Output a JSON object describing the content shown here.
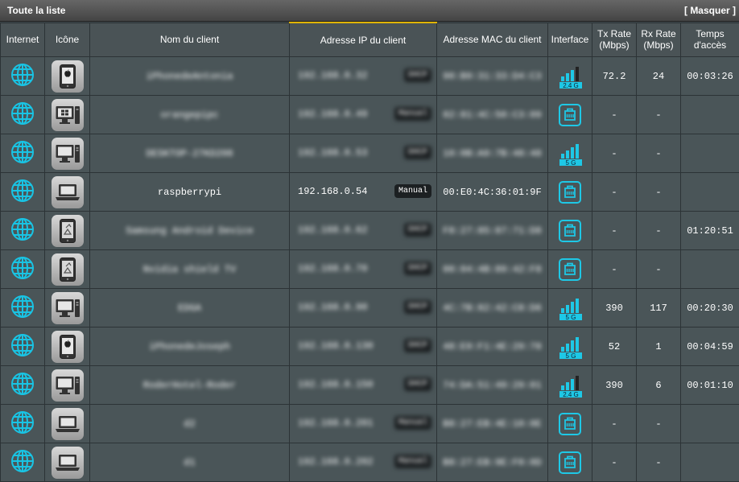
{
  "header": {
    "title": "Toute la liste",
    "hide_label": "[ Masquer ]"
  },
  "columns": [
    "Internet",
    "Icône",
    "Nom du client",
    "Adresse IP du client",
    "Adresse MAC du client",
    "Interface",
    "Tx Rate (Mbps)",
    "Rx Rate (Mbps)",
    "Temps d'accès"
  ],
  "colors": {
    "accent": "#1ec8e6",
    "sort_highlight": "#e0b400",
    "row_bg": "#4a5558",
    "header_bg": "#4a5356"
  },
  "rows": [
    {
      "device": "phone-apple",
      "name": "iPhonedeAntonia",
      "ip": "192.168.0.32",
      "tag": "DHCP",
      "mac": "90:B9:31:33:D4:C3",
      "interface": "wifi-2.4G",
      "interface_label": "2.4 G",
      "tx": "72.2",
      "rx": "24",
      "time": "00:03:26",
      "blurred": true
    },
    {
      "device": "desktop-windows",
      "name": "orangepipc",
      "ip": "192.168.0.49",
      "tag": "Manual",
      "mac": "02:81:4C:50:C3:09",
      "interface": "wired",
      "interface_label": "",
      "tx": "-",
      "rx": "-",
      "time": "",
      "blurred": true
    },
    {
      "device": "desktop",
      "name": "DESKTOP-27KD208",
      "ip": "192.168.0.53",
      "tag": "DHCP",
      "mac": "10:0B:A9:7B:48:48",
      "interface": "wifi-5G",
      "interface_label": "5 G",
      "tx": "-",
      "rx": "-",
      "time": "",
      "blurred": true
    },
    {
      "device": "laptop",
      "name": "raspberrypi",
      "ip": "192.168.0.54",
      "tag": "Manual",
      "mac": "00:E0:4C:36:01:9F",
      "interface": "wired",
      "interface_label": "",
      "tx": "-",
      "rx": "-",
      "time": "",
      "blurred": false
    },
    {
      "device": "phone-android",
      "name": "Samsung Android Device",
      "ip": "192.168.0.62",
      "tag": "DHCP",
      "mac": "F8:27:85:87:71:D8",
      "interface": "wired",
      "interface_label": "",
      "tx": "-",
      "rx": "-",
      "time": "01:20:51",
      "blurred": true
    },
    {
      "device": "phone-android",
      "name": "Nvidia shield TV",
      "ip": "192.168.0.70",
      "tag": "DHCP",
      "mac": "00:04:4B:89:42:F8",
      "interface": "wired",
      "interface_label": "",
      "tx": "-",
      "rx": "-",
      "time": "",
      "blurred": true
    },
    {
      "device": "desktop",
      "name": "EDGA",
      "ip": "192.168.0.90",
      "tag": "DHCP",
      "mac": "4C:7B:82:42:C8:D6",
      "interface": "wifi-5G",
      "interface_label": "5 G",
      "tx": "390",
      "rx": "117",
      "time": "00:20:30",
      "blurred": true
    },
    {
      "device": "phone-apple",
      "name": "iPhonedeJoseph",
      "ip": "192.168.0.130",
      "tag": "DHCP",
      "mac": "48:E9:F1:4E:29:78",
      "interface": "wifi-5G",
      "interface_label": "5 G",
      "tx": "52",
      "rx": "1",
      "time": "00:04:59",
      "blurred": true
    },
    {
      "device": "desktop",
      "name": "RoderHotel-Roder",
      "ip": "192.168.0.150",
      "tag": "DHCP",
      "mac": "74:DA:51:49:29:01",
      "interface": "wifi-2.4G",
      "interface_label": "2.4 G",
      "tx": "390",
      "rx": "6",
      "time": "00:01:10",
      "blurred": true
    },
    {
      "device": "laptop",
      "name": "d2",
      "ip": "192.168.0.201",
      "tag": "Manual",
      "mac": "B8:27:EB:4E:10:0E",
      "interface": "wired",
      "interface_label": "",
      "tx": "-",
      "rx": "-",
      "time": "",
      "blurred": true
    },
    {
      "device": "laptop",
      "name": "d1",
      "ip": "192.168.0.202",
      "tag": "Manual",
      "mac": "B8:27:EB:9E:F0:0D",
      "interface": "wired",
      "interface_label": "",
      "tx": "-",
      "rx": "-",
      "time": "",
      "blurred": true
    }
  ]
}
